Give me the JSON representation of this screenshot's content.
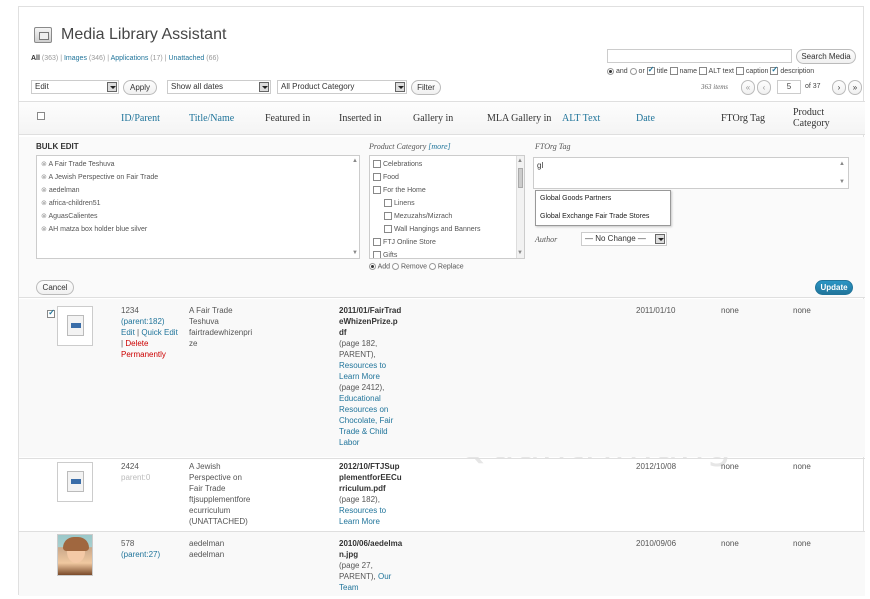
{
  "header": {
    "title": "Media Library Assistant",
    "filters": [
      {
        "label": "All",
        "count": "(363)",
        "current": true
      },
      {
        "label": "Images",
        "count": "(346)",
        "current": false
      },
      {
        "label": "Applications",
        "count": "(17)",
        "current": false
      },
      {
        "label": "Unattached",
        "count": "(66)",
        "current": false
      }
    ],
    "separator": "|"
  },
  "search": {
    "value": "",
    "button": "Search Media",
    "connector_and": "and",
    "connector_or": "or",
    "fields": [
      {
        "label": "title",
        "checked": true
      },
      {
        "label": "name",
        "checked": false
      },
      {
        "label": "ALT text",
        "checked": false
      },
      {
        "label": "caption",
        "checked": false
      },
      {
        "label": "description",
        "checked": true
      }
    ]
  },
  "toolbar": {
    "bulk_action": "Edit",
    "apply": "Apply",
    "dates": "Show all dates",
    "category": "All Product Category",
    "filter": "Filter",
    "items_count": "363 items",
    "page_current": "5",
    "page_total": "of 37",
    "first": "«",
    "prev": "‹",
    "next": "›",
    "last": "»"
  },
  "columns": [
    {
      "label": "ID/Parent",
      "link": true
    },
    {
      "label": "Title/Name",
      "link": true
    },
    {
      "label": "Featured in",
      "link": false
    },
    {
      "label": "Inserted in",
      "link": false
    },
    {
      "label": "Gallery in",
      "link": false
    },
    {
      "label": "MLA Gallery in",
      "link": false
    },
    {
      "label": "ALT Text",
      "link": true
    },
    {
      "label": "Date",
      "link": true
    },
    {
      "label": "FTOrg Tag",
      "link": false
    },
    {
      "label": "Product Category",
      "link": false
    }
  ],
  "bulk_edit": {
    "heading": "BULK EDIT",
    "items": [
      "A Fair Trade Teshuva",
      "A Jewish Perspective on Fair Trade",
      "aedelman",
      "africa-children51",
      "AguasCalientes",
      "AH matza box holder blue silver"
    ],
    "category_heading": "Product Category",
    "category_more": "[more]",
    "categories": [
      {
        "label": "Celebrations",
        "indent": 0
      },
      {
        "label": "Food",
        "indent": 0
      },
      {
        "label": "For the Home",
        "indent": 0
      },
      {
        "label": "Linens",
        "indent": 1
      },
      {
        "label": "Mezuzahs/Mizrach",
        "indent": 1
      },
      {
        "label": "Wall Hangings and Banners",
        "indent": 1
      },
      {
        "label": "FTJ Online Store",
        "indent": 0
      },
      {
        "label": "Gifts",
        "indent": 0
      }
    ],
    "category_modes": [
      {
        "label": "Add",
        "on": true
      },
      {
        "label": "Remove",
        "on": false
      },
      {
        "label": "Replace",
        "on": false
      }
    ],
    "tag_heading": "FTOrg Tag",
    "tag_value": "gl",
    "suggestions": [
      "Global Goods Partners",
      "Global Exchange Fair Trade Stores"
    ],
    "author_label": "Author",
    "author_value": "— No Change —",
    "cancel": "Cancel",
    "update": "Update"
  },
  "rows": [
    {
      "id": "1234",
      "parent": "(parent:182)",
      "actions": [
        "Edit",
        "Quick Edit",
        "Delete Permanently"
      ],
      "title_lines": [
        "A Fair Trade",
        "Teshuva",
        "fairtradewhizenpri",
        "ze"
      ],
      "inserted_lines_bold": [
        "2011/01/FairTrad",
        "eWhizenPrize.p",
        "df"
      ],
      "inserted_lines_plain": [
        "(page 182,",
        "PARENT),"
      ],
      "inserted_links": [
        "Resources to",
        "Learn More"
      ],
      "inserted_plain2": [
        "(page 2412),"
      ],
      "inserted_links2": [
        "Educational",
        "Resources on",
        "Chocolate, Fair",
        "Trade & Child",
        "Labor"
      ],
      "date": "2011/01/10",
      "ftorg": "none",
      "category": "none"
    },
    {
      "id": "2424",
      "parent": "parent:0",
      "title_lines": [
        "A Jewish",
        "Perspective on",
        "Fair Trade",
        "ftjsupplementfore",
        "ecurriculum",
        "(UNATTACHED)"
      ],
      "inserted_lines_bold": [
        "2012/10/FTJSup",
        "plementforEECu",
        "rriculum.pdf"
      ],
      "inserted_lines_plain": [
        "(page 182),"
      ],
      "inserted_links": [
        "Resources to",
        "Learn More"
      ],
      "date": "2012/10/08",
      "ftorg": "none",
      "category": "none"
    },
    {
      "id": "578",
      "parent": "(parent:27)",
      "title_lines": [
        "aedelman",
        "aedelman"
      ],
      "inserted_lines_bold": [
        "2010/06/aedelma",
        "n.jpg"
      ],
      "inserted_lines_plain": [
        "(page 27,"
      ],
      "inserted_mixed": "PARENT),",
      "inserted_mixed_link": "Our",
      "inserted_links": [
        "Team"
      ],
      "date": "2010/09/06",
      "ftorg": "none",
      "category": "none"
    }
  ],
  "watermark": "Quantrimang"
}
